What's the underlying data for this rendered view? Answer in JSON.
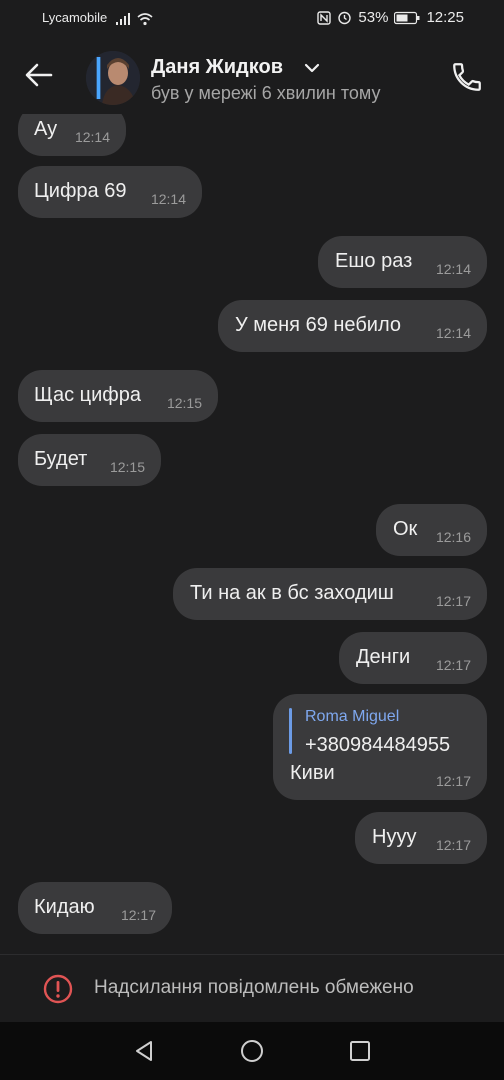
{
  "status_bar": {
    "carrier": "Lycamobile",
    "battery": "53%",
    "time": "12:25"
  },
  "header": {
    "contact_name": "Даня Жидков",
    "contact_status": "був у мережі 6 хвилин тому"
  },
  "messages": [
    {
      "text": "Ау",
      "time": "12:14",
      "direction": "in"
    },
    {
      "text": "Цифра 69",
      "time": "12:14",
      "direction": "in"
    },
    {
      "text": "Ешо раз",
      "time": "12:14",
      "direction": "out"
    },
    {
      "text": "У меня 69 небило",
      "time": "12:14",
      "direction": "out"
    },
    {
      "text": "Щас цифра",
      "time": "12:15",
      "direction": "in"
    },
    {
      "text": "Будет",
      "time": "12:15",
      "direction": "in"
    },
    {
      "text": "Ок",
      "time": "12:16",
      "direction": "out"
    },
    {
      "text": "Ти на ак в бс заходиш",
      "time": "12:17",
      "direction": "out"
    },
    {
      "text": "Денги",
      "time": "12:17",
      "direction": "out"
    },
    {
      "reply_name": "Roma Miguel",
      "reply_text": "+380984484955",
      "text": "Киви",
      "time": "12:17",
      "direction": "out"
    },
    {
      "text": "Нууу",
      "time": "12:17",
      "direction": "out"
    },
    {
      "text": "Кидаю",
      "time": "12:17",
      "direction": "in"
    }
  ],
  "footer": {
    "text": "Надсилання повідомлень обмежено"
  },
  "colors": {
    "background": "#1c1c1d",
    "bubble": "#3a3a3c",
    "accent": "#7fa8ef",
    "warning": "#e05454"
  },
  "icons": [
    "back-arrow-icon",
    "chevron-down-icon",
    "phone-icon",
    "warning-icon",
    "nav-back-icon",
    "nav-home-icon",
    "nav-recents-icon"
  ]
}
